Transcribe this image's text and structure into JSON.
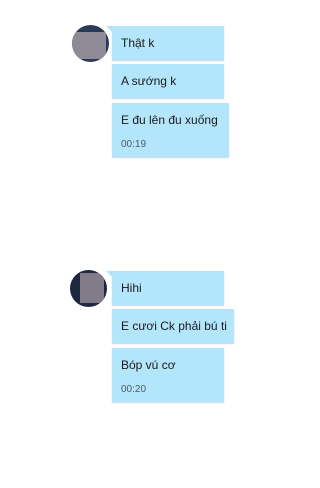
{
  "conversation": {
    "groups": [
      {
        "messages": [
          {
            "text": "Thật k"
          },
          {
            "text": "A sướng k"
          },
          {
            "text": "E đu lên đu xuống",
            "time": "00:19"
          }
        ]
      },
      {
        "messages": [
          {
            "text": "Hihi"
          },
          {
            "text": "E cươi Ck phải bú ti"
          },
          {
            "text": "Bóp vú cơ",
            "time": "00:20"
          }
        ]
      }
    ]
  },
  "colors": {
    "bubble_background": "#b3e5fb",
    "page_background": "#ffffff",
    "timestamp_text": "#4b5b66"
  },
  "icons": {
    "avatar": "avatar-icon"
  }
}
